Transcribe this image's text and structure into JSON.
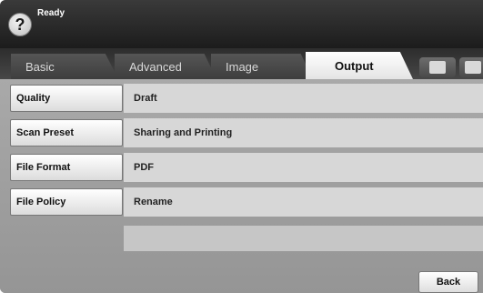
{
  "header": {
    "help_icon_glyph": "?",
    "status": "Ready"
  },
  "tabs": [
    {
      "label": "Basic"
    },
    {
      "label": "Advanced"
    },
    {
      "label": "Image"
    },
    {
      "label": "Output",
      "selected": true
    }
  ],
  "tab_icons": [
    "upload-icon",
    "home-icon"
  ],
  "settings": [
    {
      "label": "Quality",
      "value": "Draft"
    },
    {
      "label": "Scan Preset",
      "value": "Sharing and Printing"
    },
    {
      "label": "File Format",
      "value": "PDF"
    },
    {
      "label": "File Policy",
      "value": "Rename"
    }
  ],
  "footer": {
    "back_label": "Back"
  }
}
